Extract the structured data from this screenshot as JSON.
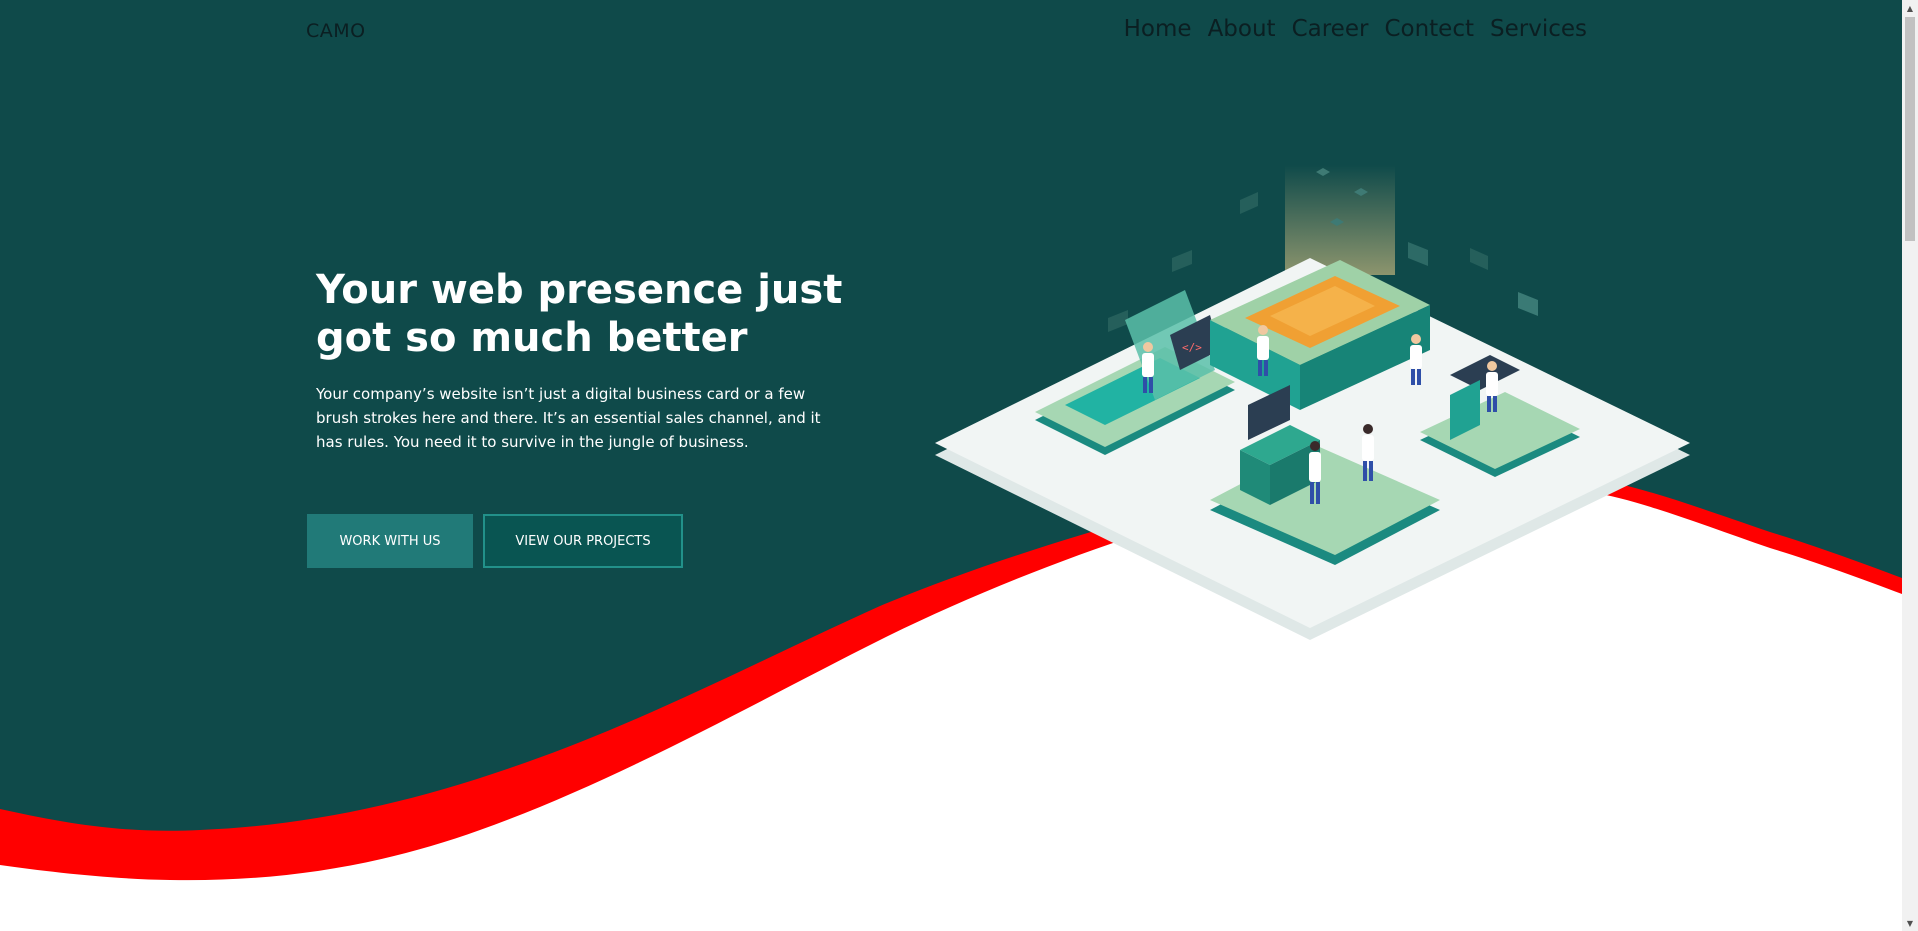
{
  "header": {
    "brand": "CAMO",
    "nav": [
      "Home",
      "About",
      "Career",
      "Contect",
      "Services"
    ]
  },
  "hero": {
    "headline": "Your web presence just got so much better",
    "subcopy": "Your company’s website isn’t just a digital business card or a few brush strokes here and there. It’s an essential sales channel, and it has rules. You need it to survive in the jungle of business.",
    "primary_button": "WORK WITH US",
    "secondary_button": "VIEW OUR PROJECTS"
  },
  "colors": {
    "hero_background": "#0f4a4a",
    "wave_accent": "#ff0000",
    "primary_button": "#217a78",
    "secondary_button": "#095552",
    "text_light": "#ffffff",
    "text_dark": "#0b1f22"
  },
  "icons": {
    "scroll_up": "scroll-up-arrow-icon",
    "scroll_down": "scroll-down-arrow-icon"
  }
}
